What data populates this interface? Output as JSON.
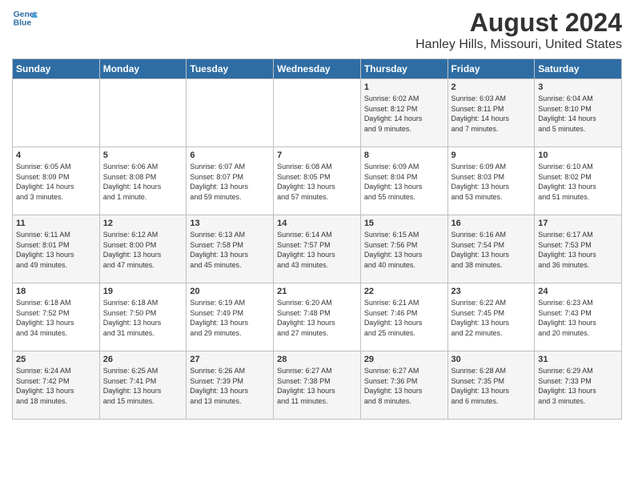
{
  "header": {
    "logo_line1": "General",
    "logo_line2": "Blue",
    "title": "August 2024",
    "subtitle": "Hanley Hills, Missouri, United States"
  },
  "columns": [
    "Sunday",
    "Monday",
    "Tuesday",
    "Wednesday",
    "Thursday",
    "Friday",
    "Saturday"
  ],
  "weeks": [
    [
      {
        "day": "",
        "info": ""
      },
      {
        "day": "",
        "info": ""
      },
      {
        "day": "",
        "info": ""
      },
      {
        "day": "",
        "info": ""
      },
      {
        "day": "1",
        "info": "Sunrise: 6:02 AM\nSunset: 8:12 PM\nDaylight: 14 hours\nand 9 minutes."
      },
      {
        "day": "2",
        "info": "Sunrise: 6:03 AM\nSunset: 8:11 PM\nDaylight: 14 hours\nand 7 minutes."
      },
      {
        "day": "3",
        "info": "Sunrise: 6:04 AM\nSunset: 8:10 PM\nDaylight: 14 hours\nand 5 minutes."
      }
    ],
    [
      {
        "day": "4",
        "info": "Sunrise: 6:05 AM\nSunset: 8:09 PM\nDaylight: 14 hours\nand 3 minutes."
      },
      {
        "day": "5",
        "info": "Sunrise: 6:06 AM\nSunset: 8:08 PM\nDaylight: 14 hours\nand 1 minute."
      },
      {
        "day": "6",
        "info": "Sunrise: 6:07 AM\nSunset: 8:07 PM\nDaylight: 13 hours\nand 59 minutes."
      },
      {
        "day": "7",
        "info": "Sunrise: 6:08 AM\nSunset: 8:05 PM\nDaylight: 13 hours\nand 57 minutes."
      },
      {
        "day": "8",
        "info": "Sunrise: 6:09 AM\nSunset: 8:04 PM\nDaylight: 13 hours\nand 55 minutes."
      },
      {
        "day": "9",
        "info": "Sunrise: 6:09 AM\nSunset: 8:03 PM\nDaylight: 13 hours\nand 53 minutes."
      },
      {
        "day": "10",
        "info": "Sunrise: 6:10 AM\nSunset: 8:02 PM\nDaylight: 13 hours\nand 51 minutes."
      }
    ],
    [
      {
        "day": "11",
        "info": "Sunrise: 6:11 AM\nSunset: 8:01 PM\nDaylight: 13 hours\nand 49 minutes."
      },
      {
        "day": "12",
        "info": "Sunrise: 6:12 AM\nSunset: 8:00 PM\nDaylight: 13 hours\nand 47 minutes."
      },
      {
        "day": "13",
        "info": "Sunrise: 6:13 AM\nSunset: 7:58 PM\nDaylight: 13 hours\nand 45 minutes."
      },
      {
        "day": "14",
        "info": "Sunrise: 6:14 AM\nSunset: 7:57 PM\nDaylight: 13 hours\nand 43 minutes."
      },
      {
        "day": "15",
        "info": "Sunrise: 6:15 AM\nSunset: 7:56 PM\nDaylight: 13 hours\nand 40 minutes."
      },
      {
        "day": "16",
        "info": "Sunrise: 6:16 AM\nSunset: 7:54 PM\nDaylight: 13 hours\nand 38 minutes."
      },
      {
        "day": "17",
        "info": "Sunrise: 6:17 AM\nSunset: 7:53 PM\nDaylight: 13 hours\nand 36 minutes."
      }
    ],
    [
      {
        "day": "18",
        "info": "Sunrise: 6:18 AM\nSunset: 7:52 PM\nDaylight: 13 hours\nand 34 minutes."
      },
      {
        "day": "19",
        "info": "Sunrise: 6:18 AM\nSunset: 7:50 PM\nDaylight: 13 hours\nand 31 minutes."
      },
      {
        "day": "20",
        "info": "Sunrise: 6:19 AM\nSunset: 7:49 PM\nDaylight: 13 hours\nand 29 minutes."
      },
      {
        "day": "21",
        "info": "Sunrise: 6:20 AM\nSunset: 7:48 PM\nDaylight: 13 hours\nand 27 minutes."
      },
      {
        "day": "22",
        "info": "Sunrise: 6:21 AM\nSunset: 7:46 PM\nDaylight: 13 hours\nand 25 minutes."
      },
      {
        "day": "23",
        "info": "Sunrise: 6:22 AM\nSunset: 7:45 PM\nDaylight: 13 hours\nand 22 minutes."
      },
      {
        "day": "24",
        "info": "Sunrise: 6:23 AM\nSunset: 7:43 PM\nDaylight: 13 hours\nand 20 minutes."
      }
    ],
    [
      {
        "day": "25",
        "info": "Sunrise: 6:24 AM\nSunset: 7:42 PM\nDaylight: 13 hours\nand 18 minutes."
      },
      {
        "day": "26",
        "info": "Sunrise: 6:25 AM\nSunset: 7:41 PM\nDaylight: 13 hours\nand 15 minutes."
      },
      {
        "day": "27",
        "info": "Sunrise: 6:26 AM\nSunset: 7:39 PM\nDaylight: 13 hours\nand 13 minutes."
      },
      {
        "day": "28",
        "info": "Sunrise: 6:27 AM\nSunset: 7:38 PM\nDaylight: 13 hours\nand 11 minutes."
      },
      {
        "day": "29",
        "info": "Sunrise: 6:27 AM\nSunset: 7:36 PM\nDaylight: 13 hours\nand 8 minutes."
      },
      {
        "day": "30",
        "info": "Sunrise: 6:28 AM\nSunset: 7:35 PM\nDaylight: 13 hours\nand 6 minutes."
      },
      {
        "day": "31",
        "info": "Sunrise: 6:29 AM\nSunset: 7:33 PM\nDaylight: 13 hours\nand 3 minutes."
      }
    ]
  ]
}
